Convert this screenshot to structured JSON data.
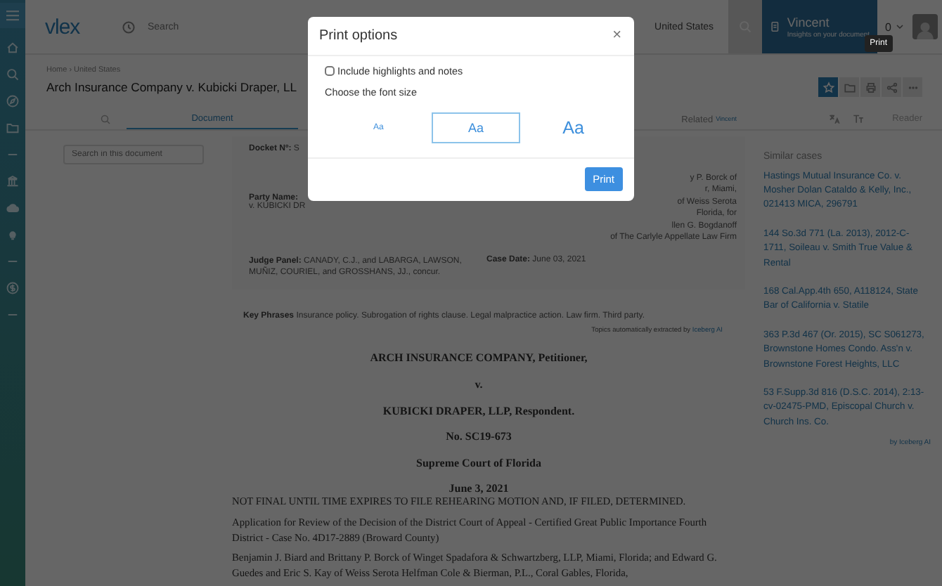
{
  "topbar": {
    "logo": "vlex",
    "search": {
      "placeholder": "Search"
    },
    "country": "United States",
    "assistant": {
      "name": "Vincent",
      "subtitle": "Insights on your document"
    },
    "counter": "0"
  },
  "breadcrumb": "Home › United States",
  "title": "Arch Insurance Company v. Kubicki Draper, LL",
  "toolbar": {
    "tooltip": "Print",
    "buttons": [
      {
        "kind": "star",
        "selected": true
      },
      {
        "kind": "folder",
        "selected": false
      },
      {
        "kind": "print",
        "selected": false
      },
      {
        "kind": "share",
        "selected": false
      },
      {
        "kind": "more",
        "selected": false
      }
    ]
  },
  "tabs": [
    {
      "label": "Document",
      "selected": true
    }
  ],
  "related": {
    "label": "Related",
    "badge": "Vincent"
  },
  "reader": "Reader",
  "doc_search": {
    "placeholder": "Search in this document"
  },
  "summary": {
    "docket_label": "Docket Nº:",
    "docket_value": "S",
    "party_label": "Party Name:",
    "party_value": "v. KUBICKI DR",
    "counsel_lines": [
      "y P. Borck of",
      "r, Miami,",
      "of Weiss Serota",
      "Florida, for",
      "llen G. Bogdanoff",
      "of The Carlyle Appellate Law Firm"
    ],
    "judge_label": "Judge Panel:",
    "judge_value": "CANADY, C.J., and LABARGA, LAWSON, MUÑIZ, COURIEL, and GROSSHANS, JJ., concur.",
    "date_label": "Case Date:",
    "date_value": "June 03, 2021"
  },
  "key_phrases": {
    "label": "Key Phrases",
    "value": "Insurance policy. Subrogation of rights clause. Legal malpractice action. Law firm. Third party.",
    "source": "Topics automatically extracted by",
    "source_link": "Iceberg AI"
  },
  "opinion": {
    "heading": [
      "ARCH INSURANCE COMPANY, Petitioner,",
      "v.",
      "KUBICKI DRAPER, LLP, Respondent.",
      "No. SC19-673",
      "Supreme Court of Florida",
      "June 3, 2021"
    ],
    "paragraphs": [
      "NOT FINAL UNTIL TIME EXPIRES TO FILE REHEARING MOTION AND, IF FILED, DETERMINED.",
      "Application for Review of the Decision of the District Court of Appeal - Certified Great Public Importance Fourth District - Case No. 4D17-2889 (Broward County)",
      "Benjamin J. Biard and Brittany P. Borck of Winget Spadafora & Schwartzberg, LLP, Miami, Florida; and Edward G. Guedes and Eric S. Kay of Weiss Serota Helfman Cole & Bierman, P.L., Coral Gables, Florida,"
    ]
  },
  "similar": {
    "title": "Similar cases",
    "items": [
      "Hastings Mutual Insurance Co. v. Mosher Dolan Cataldo & Kelly, Inc., 021413 MICA, 296791",
      "144 So.3d 771 (La. 2013), 2012-C-1711, Soileau v. Smith True Value & Rental",
      "168 Cal.App.4th 650, A118124, State Bar of California v. Statile",
      "363 P.3d 467 (Or. 2015), SC S061273, Brownstone Homes Condo. Ass'n v. Brownstone Forest Heights, LLC",
      "53 F.Supp.3d 816 (D.S.C. 2014), 2:13-cv-02475-PMD, Episcopal Church v. Church Ins. Co."
    ],
    "footer": "by Iceberg AI"
  },
  "modal": {
    "title": "Print options",
    "close": "×",
    "checkbox": {
      "label": "Include highlights and notes",
      "checked": false
    },
    "font_size_label": "Choose the font size",
    "sizes": [
      {
        "label": "Aa",
        "kind": "small",
        "selected": false
      },
      {
        "label": "Aa",
        "kind": "medium",
        "selected": true
      },
      {
        "label": "Aa",
        "kind": "large",
        "selected": false
      }
    ],
    "button": "Print"
  }
}
